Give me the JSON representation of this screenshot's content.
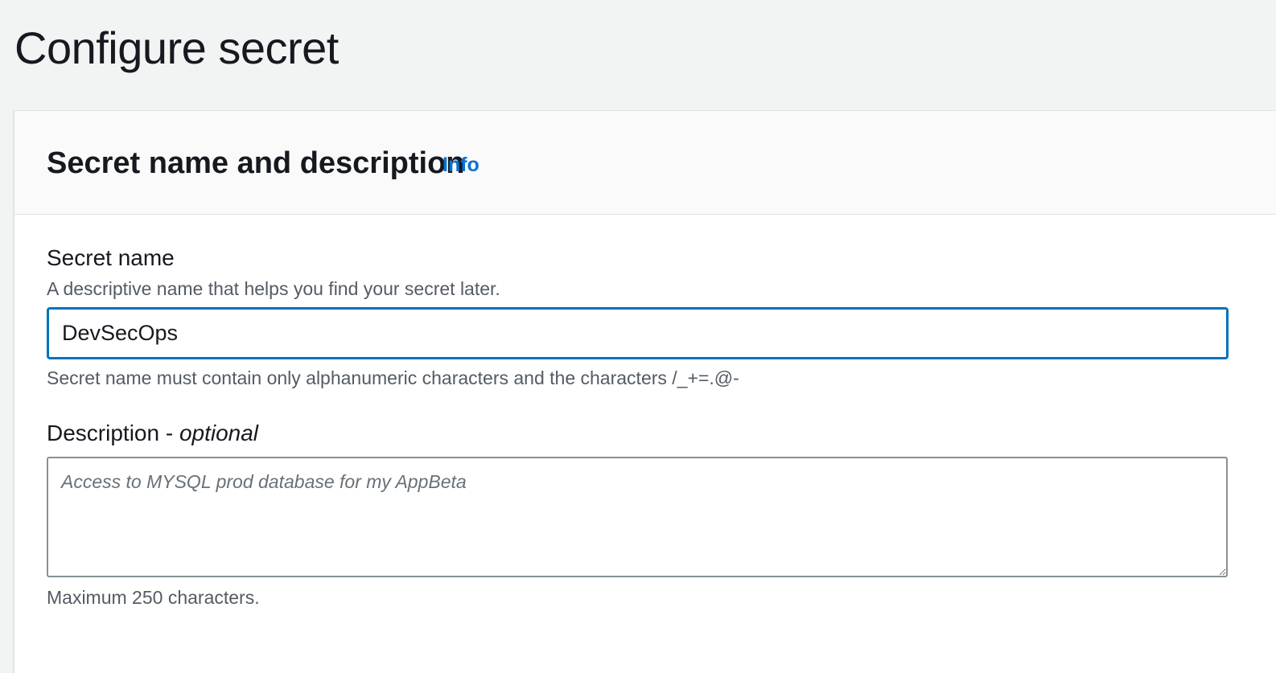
{
  "page": {
    "title": "Configure secret"
  },
  "panel": {
    "title": "Secret name and description",
    "info_label": "Info"
  },
  "secret_name": {
    "label": "Secret name",
    "description": "A descriptive name that helps you find your secret later.",
    "value": "DevSecOps",
    "constraint": "Secret name must contain only alphanumeric characters and the characters /_+=.@-"
  },
  "description_field": {
    "label": "Description - ",
    "label_optional": "optional",
    "placeholder": "Access to MYSQL prod database for my AppBeta",
    "value": "",
    "constraint": "Maximum 250 characters."
  },
  "colors": {
    "background": "#f2f3f3",
    "panel_header": "#fafafa",
    "link": "#0972d3",
    "focus_border": "#0073bb",
    "secondary_text": "#545b64"
  }
}
